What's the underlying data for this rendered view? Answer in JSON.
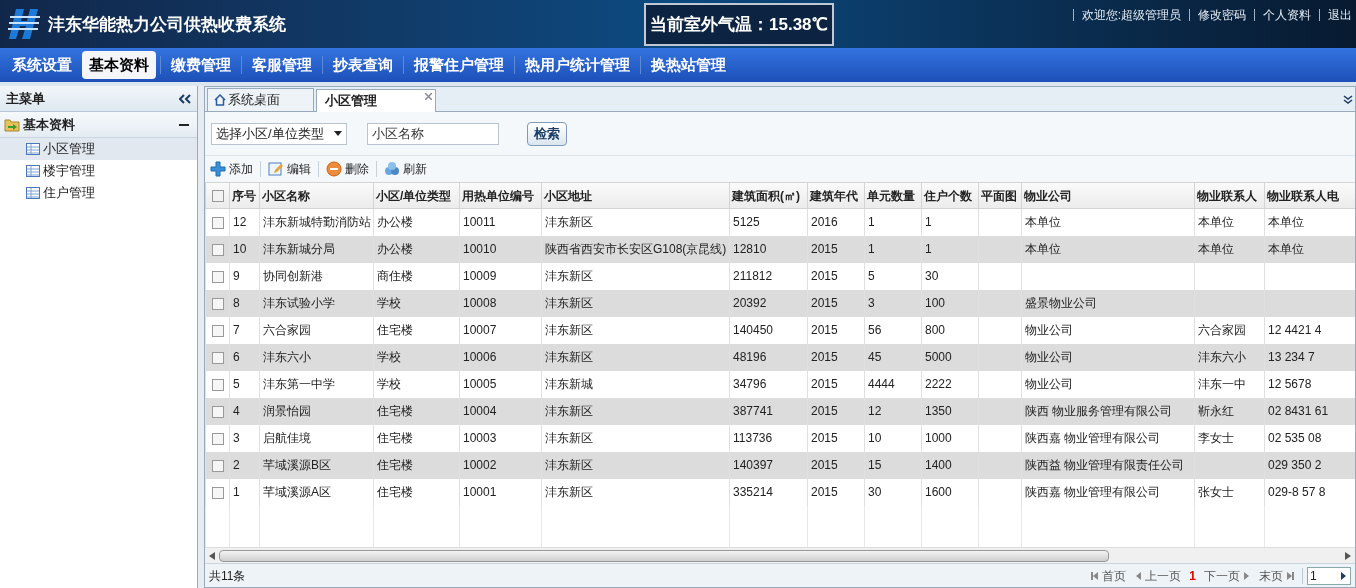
{
  "header": {
    "title": "沣东华能热力公司供热收费系统",
    "temperature": "当前室外气温：15.38℃",
    "links": [
      "欢迎您:超级管理员",
      "修改密码",
      "个人资料",
      "退出"
    ]
  },
  "nav": [
    {
      "label": "系统设置",
      "selected": false
    },
    {
      "label": "基本资料",
      "selected": true
    },
    {
      "label": "缴费管理",
      "selected": false
    },
    {
      "label": "客服管理",
      "selected": false
    },
    {
      "label": "抄表查询",
      "selected": false
    },
    {
      "label": "报警住户管理",
      "selected": false
    },
    {
      "label": "热用户统计管理",
      "selected": false
    },
    {
      "label": "换热站管理",
      "selected": false
    }
  ],
  "sidebar": {
    "title": "主菜单",
    "items": [
      {
        "label": "基本资料",
        "expanded": true,
        "children": [
          {
            "label": "小区管理",
            "selected": true
          },
          {
            "label": "楼宇管理",
            "selected": false
          },
          {
            "label": "住户管理",
            "selected": false
          }
        ]
      }
    ]
  },
  "tabs": [
    {
      "label": "系统桌面",
      "selected": false,
      "closable": false
    },
    {
      "label": "小区管理",
      "selected": true,
      "closable": true
    }
  ],
  "search": {
    "type_select": "选择小区/单位类型",
    "name_placeholder": "小区名称",
    "button": "检索"
  },
  "toolbar": [
    {
      "kind": "add",
      "label": "添加"
    },
    {
      "kind": "edit",
      "label": "编辑"
    },
    {
      "kind": "delete",
      "label": "删除"
    },
    {
      "kind": "refresh",
      "label": "刷新"
    }
  ],
  "table": {
    "columns": [
      "序号",
      "小区名称",
      "小区/单位类型",
      "用热单位编号",
      "小区地址",
      "建筑面积(㎡)",
      "建筑年代",
      "单元数量",
      "住户个数",
      "平面图",
      "物业公司",
      "物业联系人",
      "物业联系人电"
    ],
    "all_checked": false,
    "rows": [
      {
        "checked": false,
        "cells": [
          "12",
          "沣东新城特勤消防站",
          "办公楼",
          "10011",
          "沣东新区",
          "5125",
          "2016",
          "1",
          "1",
          "",
          "本单位",
          "本单位",
          "本单位"
        ]
      },
      {
        "checked": false,
        "cells": [
          "10",
          "沣东新城分局",
          "办公楼",
          "10010",
          "陕西省西安市长安区G108(京昆线)",
          "12810",
          "2015",
          "1",
          "1",
          "",
          "本单位",
          "本单位",
          "本单位"
        ]
      },
      {
        "checked": false,
        "cells": [
          "9",
          "协同创新港",
          "商住楼",
          "10009",
          "沣东新区",
          "211812",
          "2015",
          "5",
          "30",
          "",
          "",
          "",
          ""
        ]
      },
      {
        "checked": false,
        "cells": [
          "8",
          "沣东试验小学",
          "学校",
          "10008",
          "沣东新区",
          "20392",
          "2015",
          "3",
          "100",
          "",
          "盛景物业公司",
          "",
          ""
        ]
      },
      {
        "checked": false,
        "cells": [
          "7",
          "六合家园",
          "住宅楼",
          "10007",
          "沣东新区",
          "140450",
          "2015",
          "56",
          "800",
          "",
          "物业公司",
          "六合家园",
          "12 4421 4"
        ]
      },
      {
        "checked": false,
        "cells": [
          "6",
          "沣东六小",
          "学校",
          "10006",
          "沣东新区",
          "48196",
          "2015",
          "45",
          "5000",
          "",
          "物业公司",
          "沣东六小",
          "13 234 7"
        ]
      },
      {
        "checked": false,
        "cells": [
          "5",
          "沣东第一中学",
          "学校",
          "10005",
          "沣东新城",
          "34796",
          "2015",
          "4444",
          "2222",
          "",
          "物业公司",
          "沣东一中",
          "12 5678"
        ]
      },
      {
        "checked": false,
        "cells": [
          "4",
          "润景怡园",
          "住宅楼",
          "10004",
          "沣东新区",
          "387741",
          "2015",
          "12",
          "1350",
          "",
          "陕西 物业服务管理有限公司",
          "靳永红",
          "02 8431 61"
        ]
      },
      {
        "checked": false,
        "cells": [
          "3",
          "启航佳境",
          "住宅楼",
          "10003",
          "沣东新区",
          "113736",
          "2015",
          "10",
          "1000",
          "",
          "陕西嘉 物业管理有限公司",
          "李女士",
          "02 535 08"
        ]
      },
      {
        "checked": false,
        "cells": [
          "2",
          "芊域溪源B区",
          "住宅楼",
          "10002",
          "沣东新区",
          "140397",
          "2015",
          "15",
          "1400",
          "",
          "陕西益 物业管理有限责任公司",
          "",
          "029 350 2"
        ]
      },
      {
        "checked": false,
        "cells": [
          "1",
          "芊域溪源A区",
          "住宅楼",
          "10001",
          "沣东新区",
          "335214",
          "2015",
          "30",
          "1600",
          "",
          "陕西嘉 物业管理有限公司",
          "张女士",
          "029-8 57 8"
        ]
      }
    ]
  },
  "footer": {
    "total": "共11条",
    "pager": [
      {
        "kind": "first",
        "label": "首页"
      },
      {
        "kind": "prev",
        "label": "上一页"
      },
      {
        "kind": "current",
        "label": "1"
      },
      {
        "kind": "next",
        "label": "下一页"
      },
      {
        "kind": "last",
        "label": "末页"
      }
    ],
    "page_value": "1"
  }
}
